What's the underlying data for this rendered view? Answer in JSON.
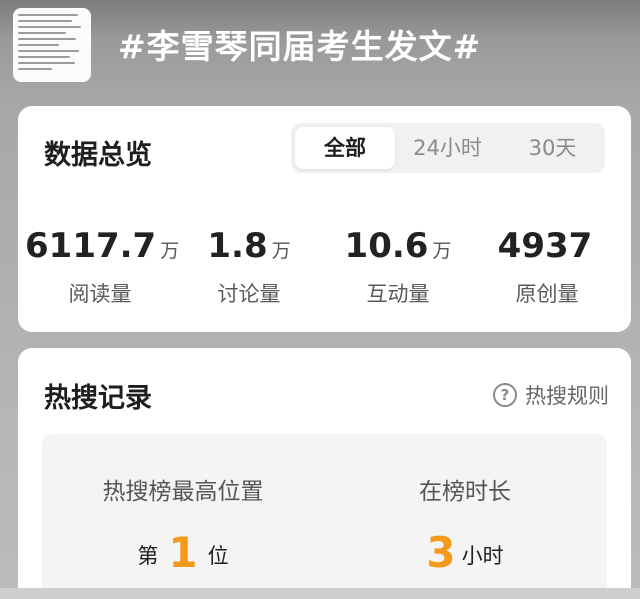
{
  "header": {
    "topic": "#李雪琴同届考生发文#",
    "thumbnail_icon": "article-thumbnail"
  },
  "overview": {
    "title": "数据总览",
    "tabs": [
      "全部",
      "24小时",
      "30天"
    ],
    "active_tab": "全部",
    "stats": [
      {
        "value": "6117.7",
        "unit": "万",
        "label": "阅读量"
      },
      {
        "value": "1.8",
        "unit": "万",
        "label": "讨论量"
      },
      {
        "value": "10.6",
        "unit": "万",
        "label": "互动量"
      },
      {
        "value": "4937",
        "unit": "",
        "label": "原创量"
      }
    ]
  },
  "hot": {
    "title": "热搜记录",
    "rules_label": "热搜规则",
    "rules_icon": "question-circle-icon",
    "max_position": {
      "label": "热搜榜最高位置",
      "prefix": "第",
      "value": "1",
      "suffix": "位"
    },
    "duration": {
      "label": "在榜时长",
      "value": "3",
      "suffix": "小时"
    },
    "accent_color": "#f39a1b"
  }
}
